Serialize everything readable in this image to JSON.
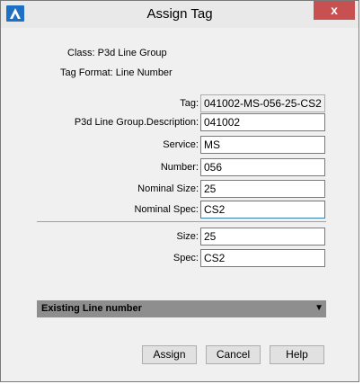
{
  "window": {
    "title": "Assign Tag",
    "close_label": "x"
  },
  "info": {
    "class_line": "Class:  P3d Line Group",
    "format_line": "Tag Format: Line Number"
  },
  "fields": [
    {
      "label": "Tag:",
      "value": "041002-MS-056-25-CS2"
    },
    {
      "label": "P3d Line Group.Description:",
      "value": "041002"
    },
    {
      "label": "Service:",
      "value": "MS"
    },
    {
      "label": "Number:",
      "value": "056"
    },
    {
      "label": "Nominal Size:",
      "value": "25"
    },
    {
      "label": "Nominal Spec:",
      "value": "CS2"
    }
  ],
  "extra_fields": [
    {
      "label": "Size:",
      "value": "25"
    },
    {
      "label": "Spec:",
      "value": "CS2"
    }
  ],
  "section": {
    "label": "Existing Line number"
  },
  "buttons": {
    "assign": "Assign",
    "cancel": "Cancel",
    "help": "Help"
  },
  "colors": {
    "close": "#c75050",
    "section_bar": "#8e8e8e",
    "focus": "#3c7fb1"
  }
}
